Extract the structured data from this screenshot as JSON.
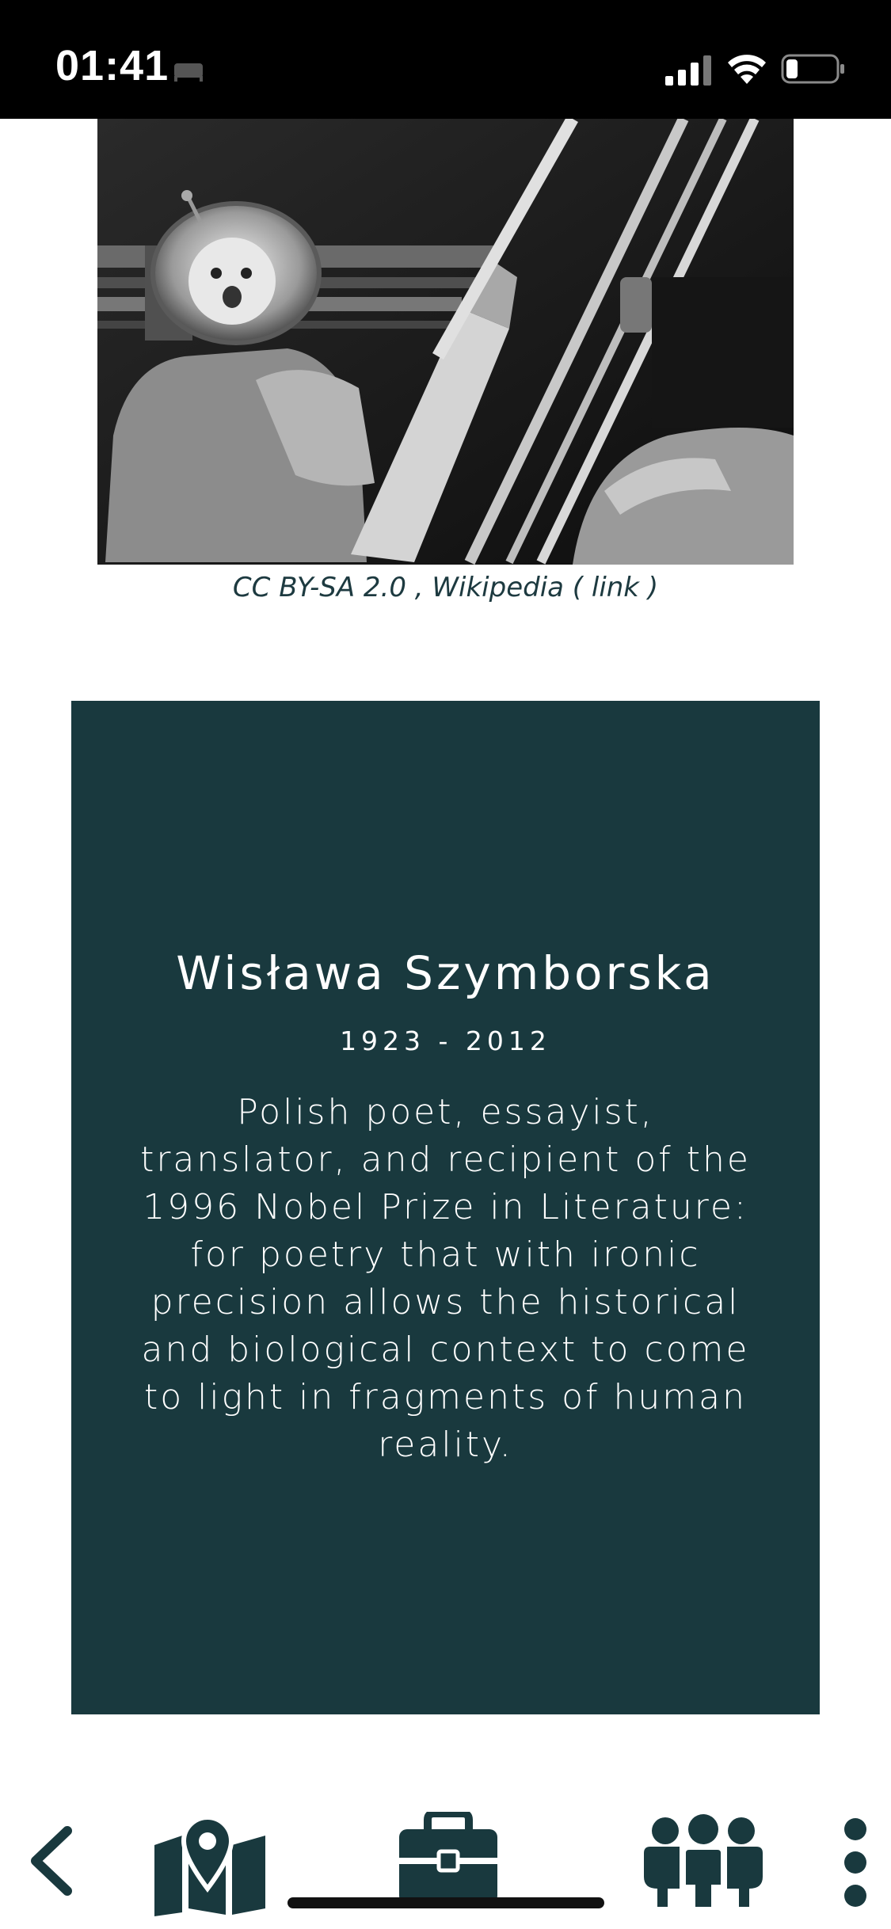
{
  "status_bar": {
    "time": "01:41"
  },
  "photo": {
    "caption_prefix": "CC BY-SA 2.0 , Wikipedia (",
    "caption_link": " link ",
    "caption_suffix": ")"
  },
  "bio": {
    "name": "Wisława Szymborska",
    "years": "1923 - 2012",
    "description": "Polish poet, essayist, translator, and recipient of the 1996 Nobel Prize in Literature: for poetry that with ironic precision allows the historical and biological context to come to light in fragments of human reality."
  },
  "bottom_nav": {
    "items": [
      {
        "icon": "back-chevron-icon"
      },
      {
        "icon": "map-icon"
      },
      {
        "icon": "briefcase-icon"
      },
      {
        "icon": "people-icon"
      },
      {
        "icon": "more-vertical-icon"
      }
    ]
  },
  "colors": {
    "card_bg": "#19393e",
    "accent": "#1d3a40"
  }
}
